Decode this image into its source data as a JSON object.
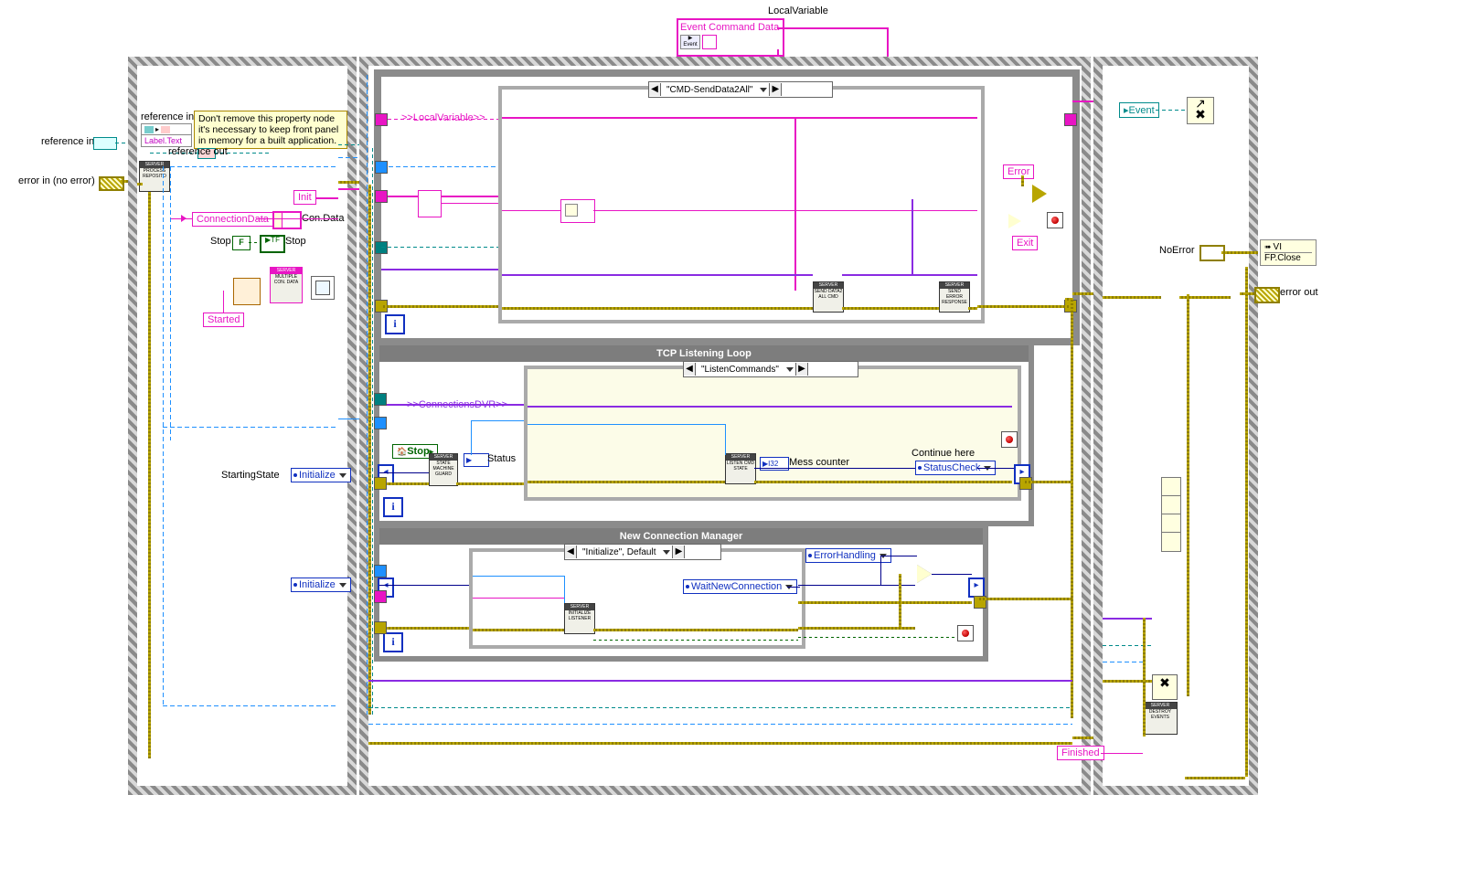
{
  "top": {
    "local_variable_title": "LocalVariable",
    "event_cmd_data": "Event Command Data"
  },
  "terminals": {
    "reference_in_top": "reference in",
    "reference_in": "reference in",
    "error_in": "error in (no error)",
    "reference_out": "reference out",
    "error_out": "error out",
    "no_error": "NoError"
  },
  "init_frame": {
    "note_line1": "Don't remove this property node",
    "note_line2": "it's necessary to keep front panel",
    "note_line3": "in memory for a built application.",
    "label_text": "Label.Text",
    "init": "Init",
    "connection_data": "ConnectionData",
    "con_data": "Con.Data",
    "stop_lbl": "Stop",
    "stop_ind": "Stop",
    "started": "Started",
    "false_const": "F",
    "tf": "TF",
    "server_repo": "SERVER",
    "server_repo2": "PROCESS REPOSITO",
    "server_mcd_hdr": "SERVER",
    "server_mcd_body": "MULTIPLE CON. DATA",
    "starting_state": "StartingState",
    "initialize1": "Initialize",
    "initialize2": "Initialize"
  },
  "loop_local": {
    "tag": ">>LocalVariable>>",
    "case_value": "\"CMD-SendData2All\"",
    "send_vi": "SEND DATA2 ALL CMD",
    "send_err_vi": "SEND ERROR RESPONSE",
    "error": "Error",
    "exit": "Exit"
  },
  "loop_tcp": {
    "title": "TCP Listening Loop",
    "case_value": "\"ListenCommands\"",
    "tag": ">>ConnectionsDVR>>",
    "stop": "Stop",
    "status": "Status",
    "listen_vi": "LISTEN CMD STATE",
    "state_guard_vi_hdr": "SERVER",
    "state_guard_vi": "STATE MACHINE GUARD",
    "mess_counter": "Mess counter",
    "i32": "I32",
    "continue_here": "Continue here",
    "status_check": "StatusCheck"
  },
  "loop_ncm": {
    "title": "New Connection Manager",
    "case_value": "\"Initialize\", Default",
    "init_listener_vi": "INITIALIZE LISTENER",
    "wait_new": "WaitNewConnection",
    "error_handling": "ErrorHandling"
  },
  "cleanup": {
    "event": "Event",
    "vi_fp_close_l1": "VI",
    "vi_fp_close_l2": "FP.Close",
    "destroy_events_hdr": "SERVER",
    "destroy_events": "DESTROY EVENTS",
    "finished": "Finished"
  }
}
